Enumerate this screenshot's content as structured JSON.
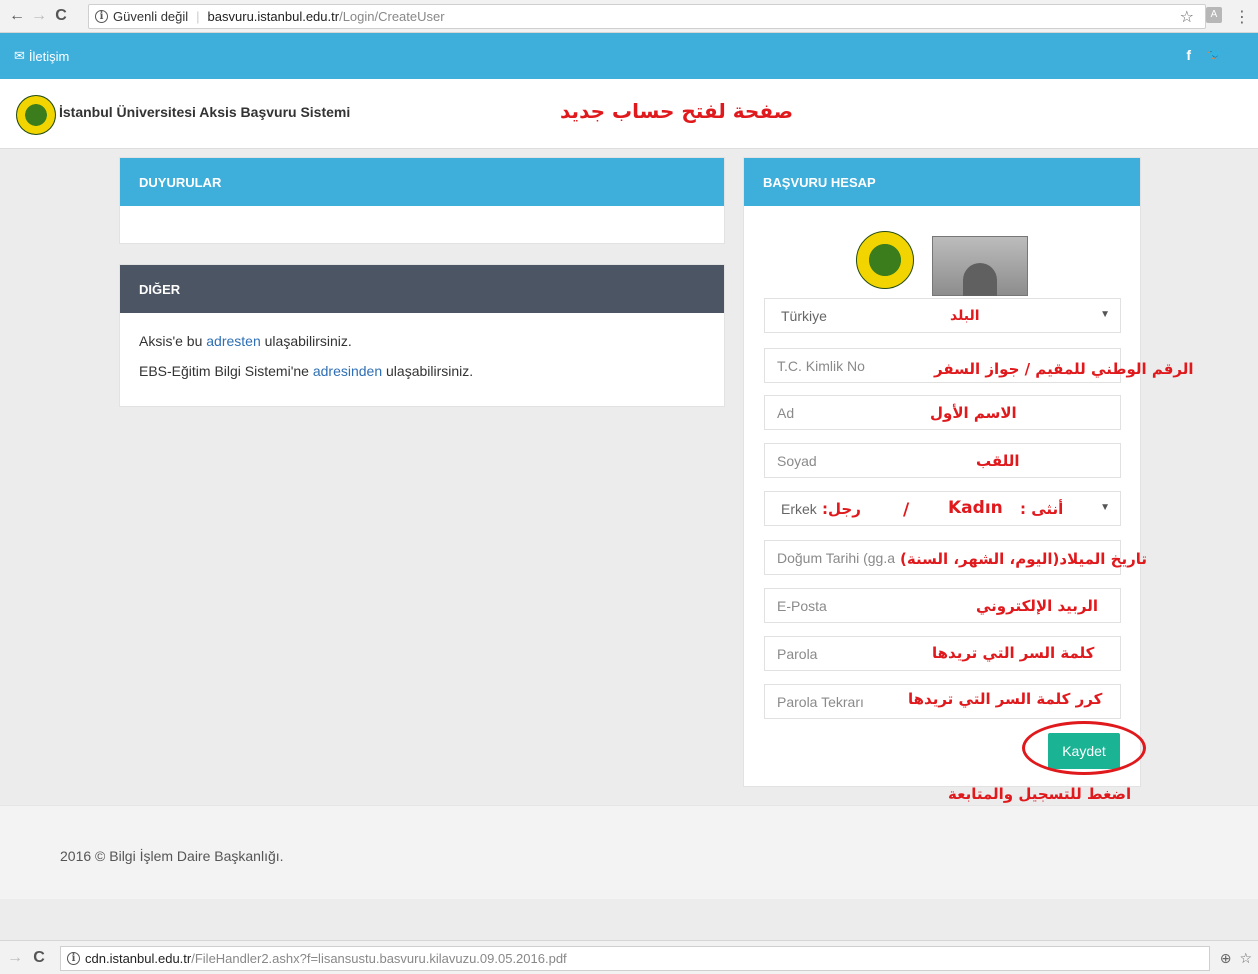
{
  "browser": {
    "back_icon": "←",
    "forward_icon": "→",
    "reload_icon": "C",
    "security_text": "Güvenli değil",
    "url_host": "basvuru.istanbul.edu.tr",
    "url_path": "/Login/CreateUser",
    "star_icon": "☆",
    "ext_icon": "A",
    "menu_icon": "⋮"
  },
  "topbar": {
    "contact": "İletişim",
    "facebook": "f",
    "twitter": "🐦"
  },
  "header": {
    "title": "İstanbul Üniversitesi Aksis Başvuru Sistemi",
    "annotation": "صفحة لفتح حساب جديد"
  },
  "announcements": {
    "title": "DUYURULAR"
  },
  "other": {
    "title": "DIĞER",
    "line1_pre": "Aksis'e bu ",
    "line1_link": "adresten",
    "line1_post": " ulaşabilirsiniz.",
    "line2_pre": "EBS-Eğitim Bilgi Sistemi'ne ",
    "line2_link": "adresinden",
    "line2_post": " ulaşabilirsiniz."
  },
  "account": {
    "title": "BAŞVURU HESAP",
    "country": "Türkiye",
    "country_note": "البلد",
    "tc_placeholder": "T.C. Kimlik No",
    "tc_note": "الرقم الوطني للمقيم / جواز السفر",
    "name_placeholder": "Ad",
    "name_note": "الاسم الأول",
    "surname_placeholder": "Soyad",
    "surname_note": "اللقب",
    "gender": "Erkek",
    "gender_note_male": "رجل:",
    "gender_slash": "/",
    "gender_female": "Kadın",
    "gender_note_female": "أنثى :",
    "birth_placeholder": "Doğum Tarihi (gg.a",
    "birth_note": "تاريخ الميلاد(اليوم، الشهر، السنة)",
    "email_placeholder": "E-Posta",
    "email_note": "الربيد الإلكتروني",
    "password_placeholder": "Parola",
    "password_note": "كلمة السر التي تريدها",
    "password2_placeholder": "Parola Tekrarı",
    "password2_note": "كرر كلمة السر التي تريدها",
    "save_label": "Kaydet",
    "save_note": "اضغط للتسجيل والمتابعة"
  },
  "footer": {
    "copyright": "2016 © Bilgi İşlem Daire Başkanlığı."
  },
  "bottom_bar": {
    "url_host": "cdn.istanbul.edu.tr",
    "url_path": "/FileHandler2.ashx?f=lisansustu.basvuru.kilavuzu.09.05.2016.pdf",
    "zoom_icon": "⊕"
  }
}
